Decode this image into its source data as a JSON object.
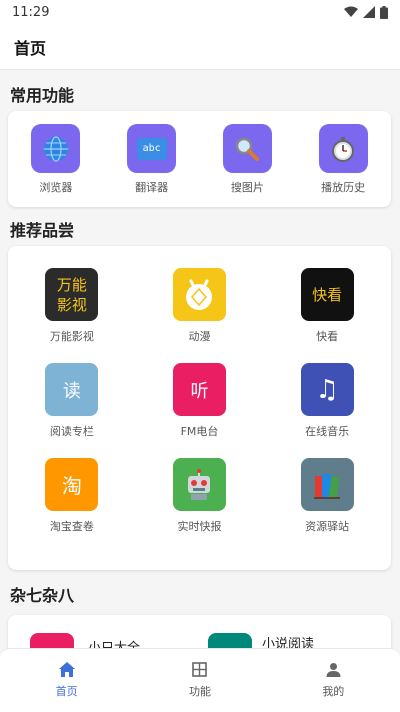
{
  "status": {
    "time": "11:29"
  },
  "app_bar": {
    "title": "首页"
  },
  "sections": {
    "common": "常用功能",
    "recommend": "推荐品尝",
    "misc": "杂七杂八"
  },
  "common_functions": [
    {
      "label": "浏览器",
      "icon": "globe-icon"
    },
    {
      "label": "翻译器",
      "icon": "abc-translate-icon",
      "icon_text": "abc"
    },
    {
      "label": "搜图片",
      "icon": "magnifier-icon"
    },
    {
      "label": "播放历史",
      "icon": "stopwatch-icon"
    }
  ],
  "recommend": [
    {
      "label": "万能影视",
      "icon_text": "万能\n影视",
      "color": "#2b2b2b"
    },
    {
      "label": "动漫",
      "icon_text": "",
      "color": "#f5c518"
    },
    {
      "label": "快看",
      "icon_text": "快看",
      "color": "#111111"
    },
    {
      "label": "阅读专栏",
      "icon_text": "读",
      "color": "#7fb3d5"
    },
    {
      "label": "FM电台",
      "icon_text": "听",
      "color": "#e91e63"
    },
    {
      "label": "在线音乐",
      "icon_text": "♫",
      "color": "#3f51b5"
    },
    {
      "label": "淘宝查卷",
      "icon_text": "淘",
      "color": "#ff9800"
    },
    {
      "label": "实时快报",
      "icon_text": "",
      "color": "#4caf50"
    },
    {
      "label": "资源驿站",
      "icon_text": "",
      "color": "#607d8b"
    }
  ],
  "misc_items": [
    {
      "label": "小只大全",
      "color": "#e91e63"
    },
    {
      "label": "小说阅读",
      "color": "#00897b"
    }
  ],
  "bottom_nav": [
    {
      "label": "首页",
      "active": true,
      "icon": "home-icon"
    },
    {
      "label": "功能",
      "active": false,
      "icon": "grid-icon"
    },
    {
      "label": "我的",
      "active": false,
      "icon": "person-icon"
    }
  ],
  "colors": {
    "accent": "#3f6fd8",
    "func_icon_bg": "#7b68ee",
    "inactive_nav": "#666666"
  }
}
